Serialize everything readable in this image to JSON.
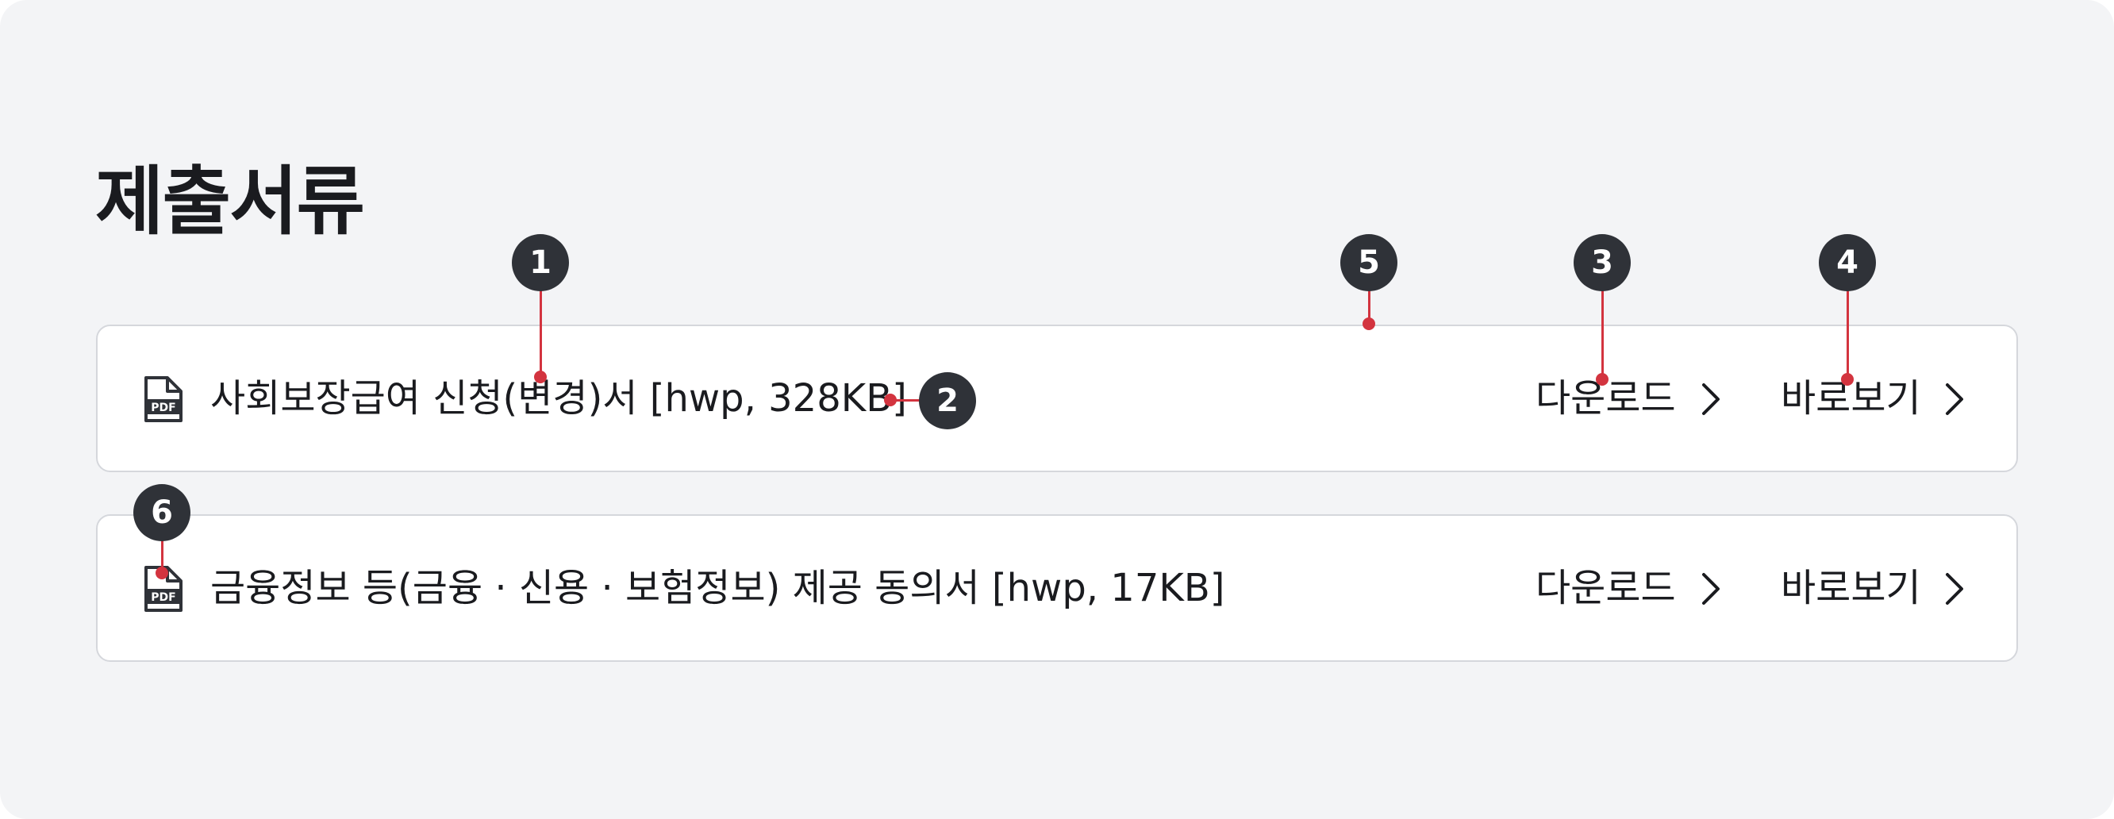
{
  "section": {
    "title": "제출서류"
  },
  "documents": [
    {
      "icon": "pdf-file-icon",
      "name": "사회보장급여 신청(변경)서 [hwp, 328KB]",
      "download_label": "다운로드",
      "view_label": "바로보기"
    },
    {
      "icon": "pdf-file-icon",
      "name": "금융정보 등(금융 · 신용 · 보험정보) 제공 동의서 [hwp, 17KB]",
      "download_label": "다운로드",
      "view_label": "바로보기"
    }
  ],
  "annotations": {
    "markers": [
      "1",
      "2",
      "3",
      "4",
      "5",
      "6"
    ]
  },
  "colors": {
    "background": "#f3f4f6",
    "card": "#ffffff",
    "card_border": "#d5d7dc",
    "text": "#1a1b1f",
    "marker": "#2f3238",
    "annotation_line": "#d3343f"
  }
}
